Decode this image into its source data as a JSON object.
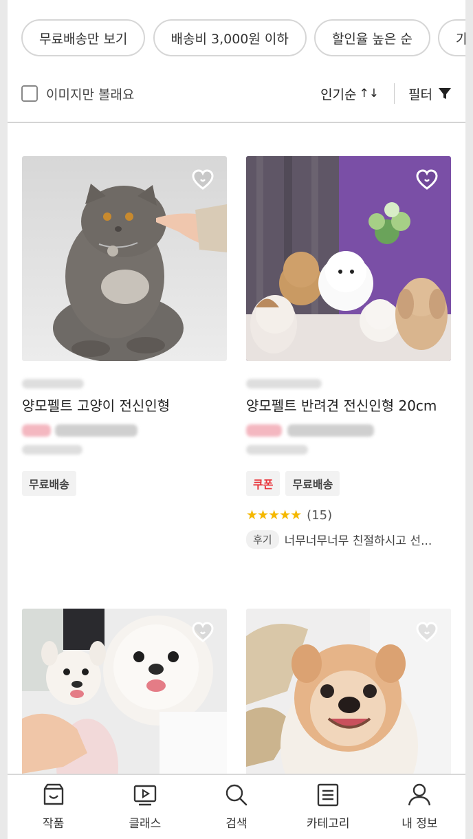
{
  "filter_chips": [
    "무료배송만 보기",
    "배송비 3,000원 이하",
    "할인율 높은 순",
    "가격"
  ],
  "toolbar": {
    "image_only_label": "이미지만 볼래요",
    "sort_label": "인기순",
    "sort_icon": "↑↓",
    "filter_label": "필터"
  },
  "products": [
    {
      "title": "양모펠트 고양이 전신인형",
      "tags": [
        "무료배송"
      ]
    },
    {
      "title": "양모펠트 반려견 전신인형 20cm",
      "tags": [
        "쿠폰",
        "무료배송"
      ],
      "rating_stars": "★★★★★",
      "review_count": "(15)",
      "review_badge": "후기",
      "review_text": "너무너무너무 친절하시고 선..."
    },
    {
      "title": ""
    },
    {
      "title": ""
    }
  ],
  "bottom_nav": [
    {
      "label": "작품",
      "icon": "shop-icon"
    },
    {
      "label": "클래스",
      "icon": "play-icon"
    },
    {
      "label": "검색",
      "icon": "search-icon"
    },
    {
      "label": "카테고리",
      "icon": "list-icon"
    },
    {
      "label": "내 정보",
      "icon": "person-icon"
    }
  ],
  "colors": {
    "coupon": "#e8333a",
    "star": "#f5b800",
    "chip_border": "#d6d6d6"
  }
}
